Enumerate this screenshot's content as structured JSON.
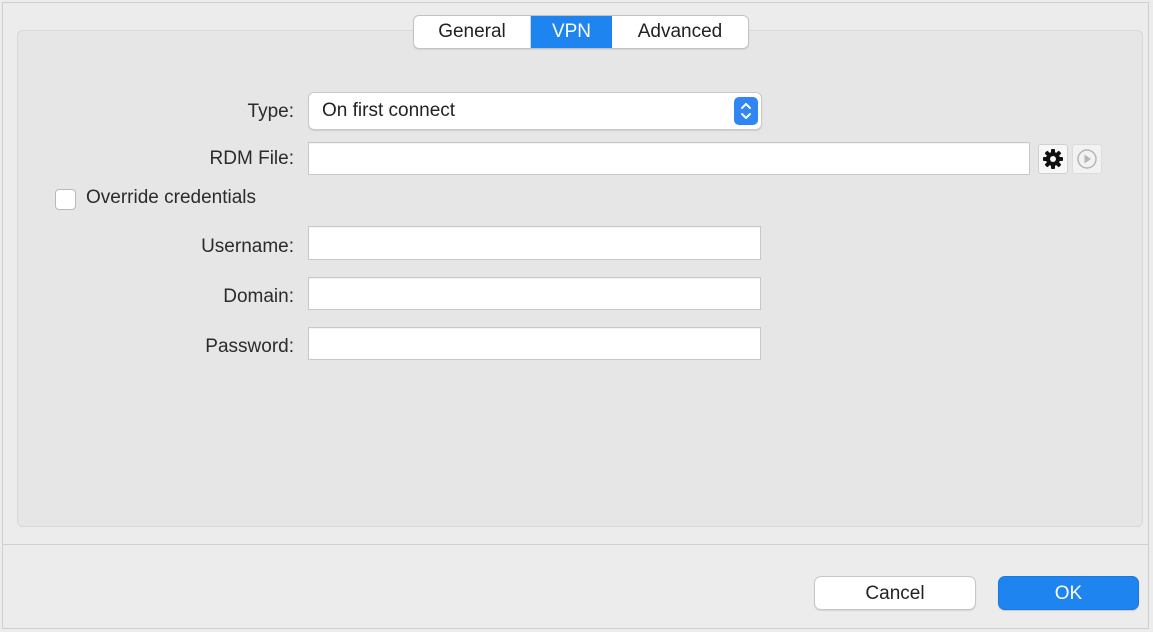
{
  "tabs": [
    {
      "label": "General",
      "selected": false
    },
    {
      "label": "VPN",
      "selected": true
    },
    {
      "label": "Advanced",
      "selected": false
    }
  ],
  "form": {
    "type_label": "Type:",
    "type_value": "On first connect",
    "rdm_file_label": "RDM File:",
    "rdm_file_value": "",
    "override_label": "Override credentials",
    "override_checked": false,
    "username_label": "Username:",
    "username_value": "",
    "domain_label": "Domain:",
    "domain_value": "",
    "password_label": "Password:",
    "password_value": ""
  },
  "icons": {
    "rdm_settings": "gear-icon",
    "rdm_execute": "play-icon",
    "select_stepper": "chevron-up-down-icon"
  },
  "buttons": {
    "cancel": "Cancel",
    "ok": "OK"
  },
  "colors": {
    "accent": "#1e84f0"
  }
}
